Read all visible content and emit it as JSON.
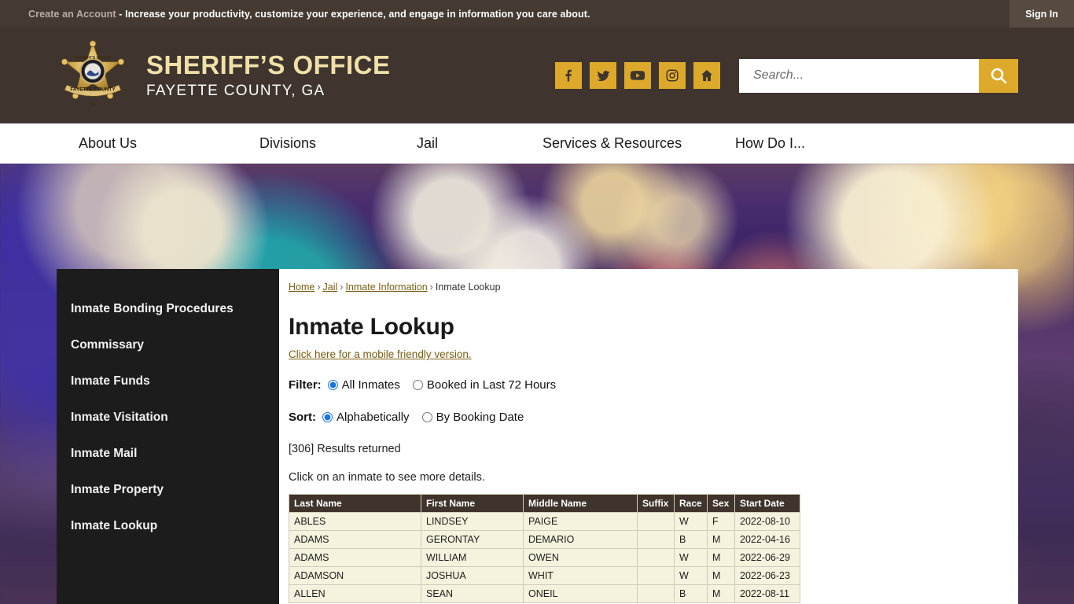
{
  "topbar": {
    "account_link": "Create an Account",
    "message": " - Increase your productivity, customize your experience, and engage in information you care about.",
    "sign_in": "Sign In"
  },
  "header": {
    "site_title": "SHERIFF’S OFFICE",
    "site_subtitle": "FAYETTE COUNTY, GA",
    "logo_name": "sheriff-star-badge",
    "socials": [
      {
        "name": "facebook-icon",
        "label": "Facebook"
      },
      {
        "name": "twitter-icon",
        "label": "Twitter"
      },
      {
        "name": "youtube-icon",
        "label": "YouTube"
      },
      {
        "name": "instagram-icon",
        "label": "Instagram"
      },
      {
        "name": "nextdoor-home-icon",
        "label": "Nextdoor"
      }
    ],
    "search_placeholder": "Search...",
    "search_value": "",
    "accent_color": "#dda92b",
    "header_bg": "#3f352e"
  },
  "nav": {
    "items": [
      {
        "label": "About Us"
      },
      {
        "label": "Divisions"
      },
      {
        "label": "Jail"
      },
      {
        "label": "Services & Resources"
      },
      {
        "label": "How Do I..."
      }
    ]
  },
  "sidebar": {
    "items": [
      {
        "label": "Inmate Bonding Procedures"
      },
      {
        "label": "Commissary"
      },
      {
        "label": "Inmate Funds"
      },
      {
        "label": "Inmate Visitation"
      },
      {
        "label": "Inmate Mail"
      },
      {
        "label": "Inmate Property"
      },
      {
        "label": "Inmate Lookup"
      }
    ]
  },
  "breadcrumb": {
    "items": [
      {
        "label": "Home",
        "link": true
      },
      {
        "label": "Jail",
        "link": true
      },
      {
        "label": "Inmate Information",
        "link": true
      },
      {
        "label": "Inmate Lookup",
        "link": false
      }
    ],
    "separator": "›"
  },
  "main": {
    "page_title": "Inmate Lookup",
    "mobile_link": "Click here for a mobile friendly version.",
    "filter": {
      "label": "Filter:",
      "options": [
        {
          "label": "All Inmates",
          "selected": true
        },
        {
          "label": "Booked in Last 72 Hours",
          "selected": false
        }
      ]
    },
    "sort": {
      "label": "Sort:",
      "options": [
        {
          "label": "Alphabetically",
          "selected": true
        },
        {
          "label": "By Booking Date",
          "selected": false
        }
      ]
    },
    "results_text": "[306] Results returned",
    "results_count": 306,
    "hint_text": "Click on an inmate to see more details.",
    "table": {
      "columns": [
        "Last Name",
        "First Name",
        "Middle Name",
        "Suffix",
        "Race",
        "Sex",
        "Start Date"
      ],
      "rows": [
        [
          "ABLES",
          "LINDSEY",
          "PAIGE",
          "",
          "W",
          "F",
          "2022-08-10"
        ],
        [
          "ADAMS",
          "GERONTAY",
          "DEMARIO",
          "",
          "B",
          "M",
          "2022-04-16"
        ],
        [
          "ADAMS",
          "WILLIAM",
          "OWEN",
          "",
          "W",
          "M",
          "2022-06-29"
        ],
        [
          "ADAMSON",
          "JOSHUA",
          "WHIT",
          "",
          "W",
          "M",
          "2022-06-23"
        ],
        [
          "ALLEN",
          "SEAN",
          "ONEIL",
          "",
          "B",
          "M",
          "2022-08-11"
        ]
      ]
    }
  }
}
